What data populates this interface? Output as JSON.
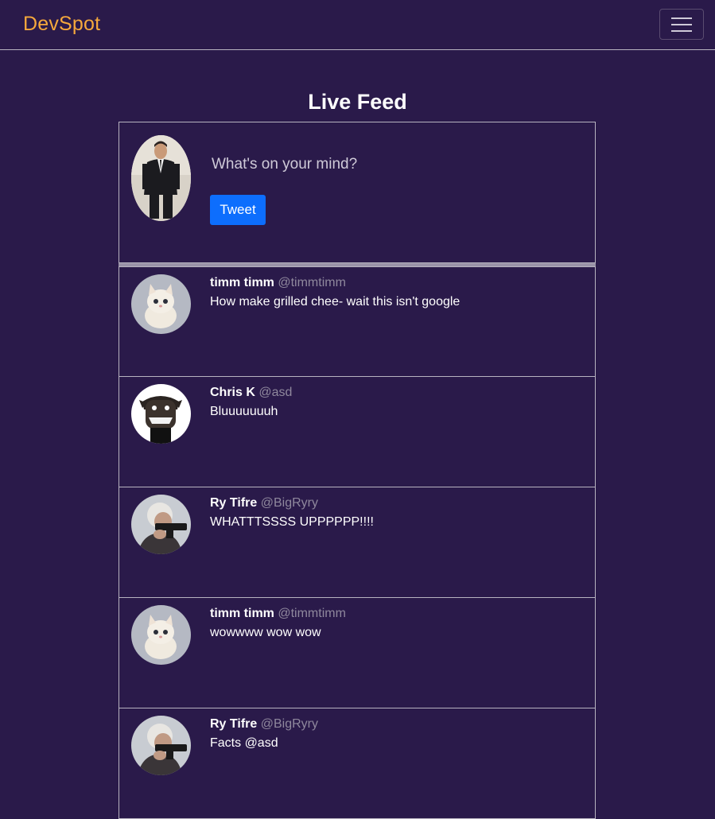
{
  "nav": {
    "brand": "DevSpot",
    "toggle_icon": "hamburger-menu-icon"
  },
  "page": {
    "title": "Live Feed"
  },
  "composer": {
    "placeholder": "What's on your mind?",
    "tweet_label": "Tweet"
  },
  "posts": [
    {
      "name": "timm timm",
      "handle": "@timmtimm",
      "text": "How make grilled chee- wait this isn't google",
      "avatar": "kitten"
    },
    {
      "name": "Chris K",
      "handle": "@asd",
      "text": "Bluuuuuuuh",
      "avatar": "cartoon-cow"
    },
    {
      "name": "Ry Tifre",
      "handle": "@BigRyry",
      "text": "WHATTTSSSS UPPPPPP!!!!",
      "avatar": "granny-with-gun"
    },
    {
      "name": "timm timm",
      "handle": "@timmtimm",
      "text": "wowwww wow wow",
      "avatar": "kitten"
    },
    {
      "name": "Ry Tifre",
      "handle": "@BigRyry",
      "text": "Facts @asd",
      "avatar": "granny-with-gun"
    }
  ],
  "colors": {
    "background": "#2a1a4a",
    "brand": "#f5a83c",
    "primary_button": "#0d6efd",
    "handle": "#8f889d"
  }
}
